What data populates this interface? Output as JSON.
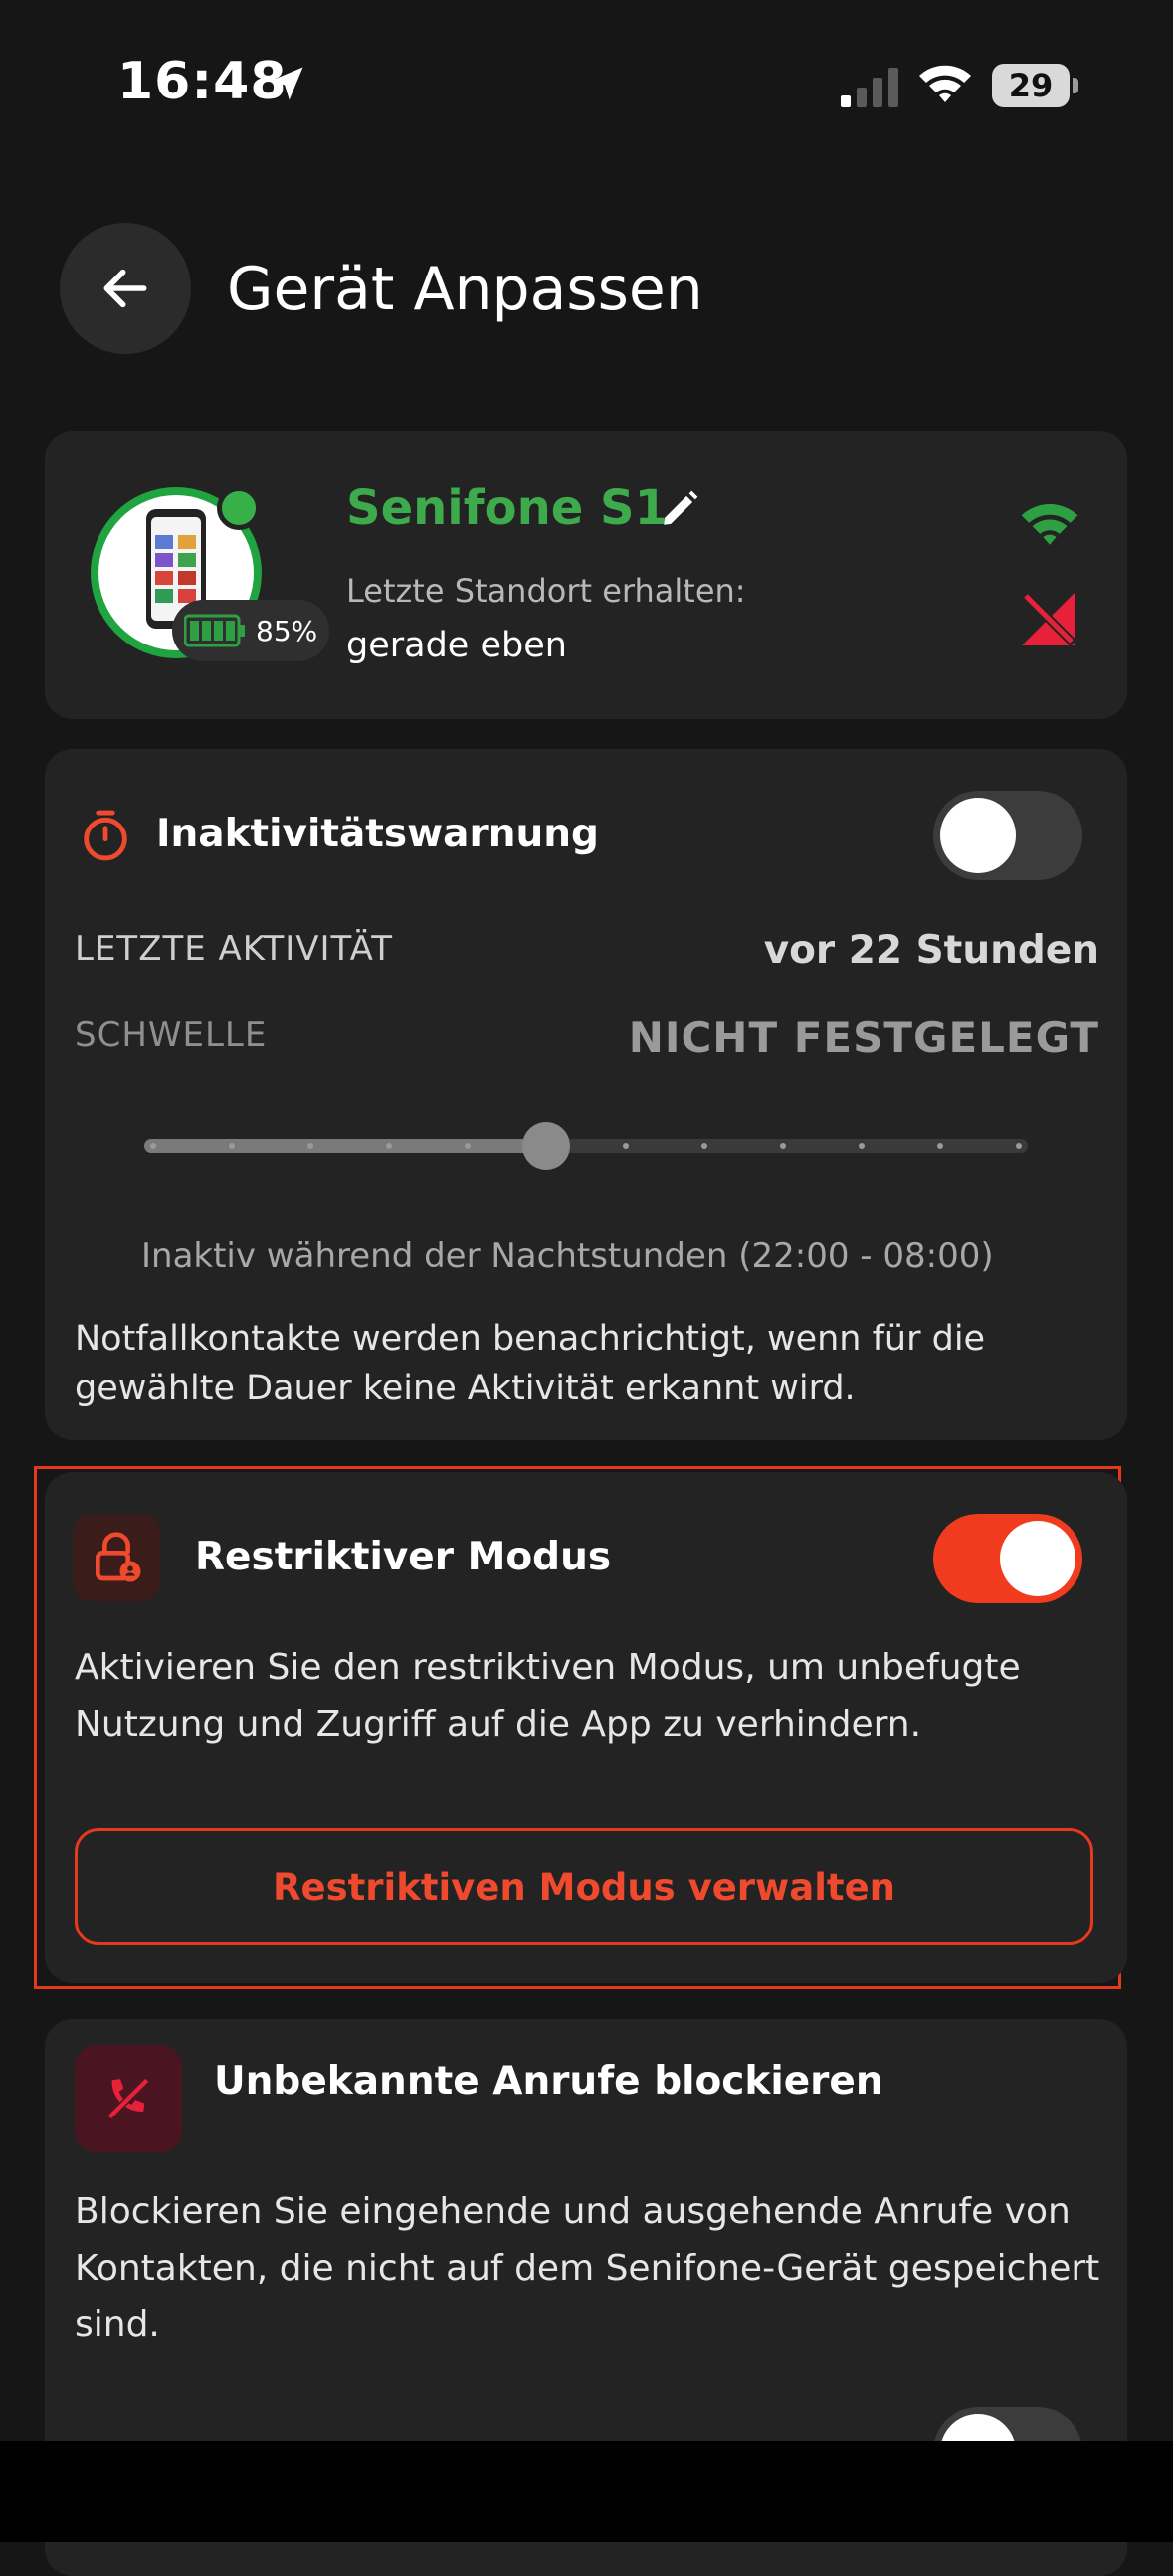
{
  "status_bar": {
    "time": "16:48",
    "battery": "29"
  },
  "header": {
    "title": "Gerät Anpassen"
  },
  "device": {
    "name": "Senifone S1",
    "battery_percent": "85%",
    "location_label": "Letzte Standort erhalten:",
    "location_value": "gerade eben"
  },
  "inactivity": {
    "title": "Inaktivitätswarnung",
    "enabled": false,
    "last_activity_label": "LETZTE AKTIVITÄT",
    "last_activity_value": "vor 22 Stunden",
    "threshold_label": "SCHWELLE",
    "threshold_value": "NICHT FESTGELEGT",
    "slider_steps": 12,
    "slider_position": 0.455,
    "night_text": "Inaktiv während der Nachtstunden (22:00 - 08:00)",
    "description": "Notfallkontakte werden benachrichtigt, wenn für die gewählte Dauer keine Aktivität erkannt wird."
  },
  "restrictive": {
    "title": "Restriktiver Modus",
    "enabled": true,
    "description": "Aktivieren Sie den restriktiven Modus, um unbefugte Nutzung und Zugriff auf die App zu verhindern.",
    "manage_label": "Restriktiven Modus verwalten"
  },
  "unknown_calls": {
    "title": "Unbekannte Anrufe blockieren",
    "description": "Blockieren Sie eingehende und ausgehende Anrufe von Kontakten, die nicht auf dem Senifone-Gerät gespeichert sind."
  },
  "colors": {
    "accent_red": "#f03b1f",
    "online_green": "#3daa4c"
  }
}
